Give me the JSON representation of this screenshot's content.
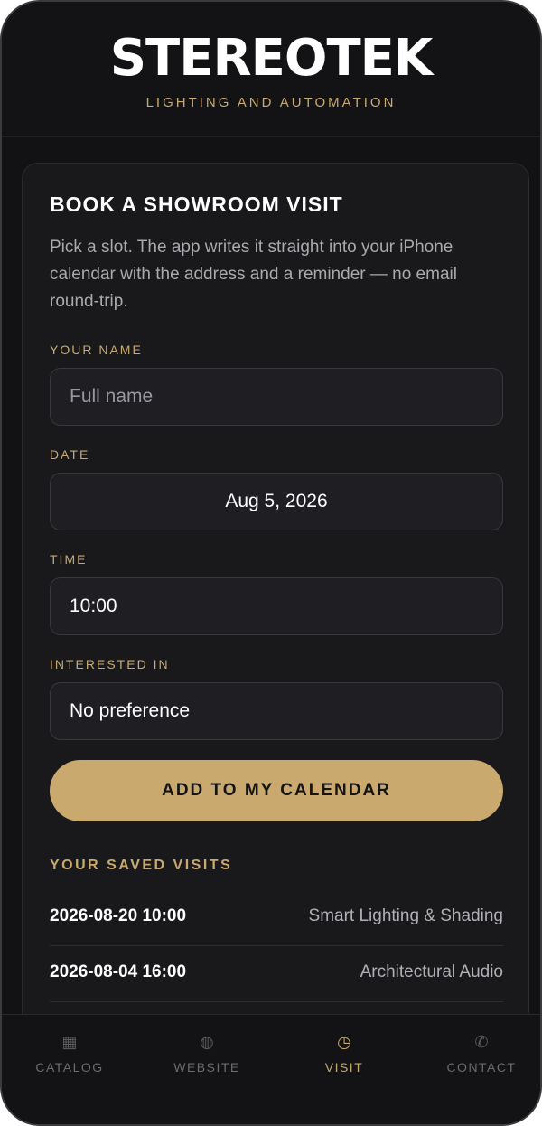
{
  "header": {
    "brand": "STEREOTEK",
    "tagline": "LIGHTING AND AUTOMATION"
  },
  "booking": {
    "title": "BOOK A SHOWROOM VISIT",
    "description": "Pick a slot. The app writes it straight into your iPhone calendar with the address and a reminder — no email round-trip.",
    "name_label": "YOUR NAME",
    "name_placeholder": "Full name",
    "name_value": "",
    "date_label": "DATE",
    "date_value": "Aug 5, 2026",
    "time_label": "TIME",
    "time_value": "10:00",
    "interest_label": "INTERESTED IN",
    "interest_value": "No preference",
    "submit_label": "ADD TO MY CALENDAR"
  },
  "saved": {
    "title": "YOUR SAVED VISITS",
    "items": [
      {
        "when": "2026-08-20 10:00",
        "what": "Smart Lighting & Shading"
      },
      {
        "when": "2026-08-04 16:00",
        "what": "Architectural Audio"
      }
    ]
  },
  "tabs": [
    {
      "label": "CATALOG",
      "icon": "grid-icon",
      "glyph": "▦",
      "active": false
    },
    {
      "label": "WEBSITE",
      "icon": "globe-icon",
      "glyph": "◍",
      "active": false
    },
    {
      "label": "VISIT",
      "icon": "clock-icon",
      "glyph": "◷",
      "active": true
    },
    {
      "label": "CONTACT",
      "icon": "phone-icon",
      "glyph": "✆",
      "active": false
    }
  ],
  "colors": {
    "accent": "#c9a96e",
    "background": "#121214",
    "card": "#19191c"
  }
}
